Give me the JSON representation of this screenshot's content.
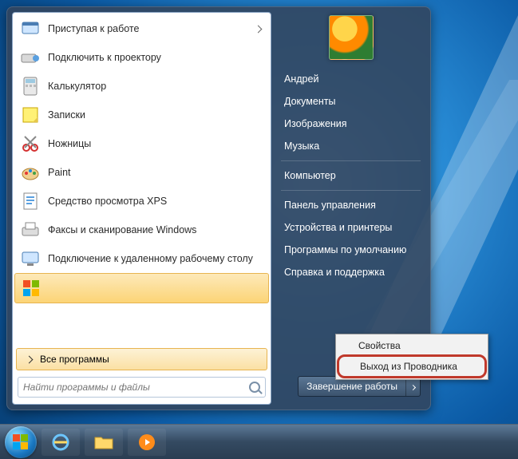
{
  "programs": [
    {
      "label": "Приступая к работе",
      "icon": "getting-started",
      "hasSubmenu": true
    },
    {
      "label": "Подключить к проектору",
      "icon": "projector"
    },
    {
      "label": "Калькулятор",
      "icon": "calculator"
    },
    {
      "label": "Записки",
      "icon": "sticky-notes"
    },
    {
      "label": "Ножницы",
      "icon": "snipping"
    },
    {
      "label": "Paint",
      "icon": "paint"
    },
    {
      "label": "Средство просмотра XPS",
      "icon": "xps-viewer"
    },
    {
      "label": "Факсы и сканирование Windows",
      "icon": "fax-scan"
    },
    {
      "label": "Подключение к удаленному рабочему столу",
      "icon": "remote-desktop"
    },
    {
      "label": "",
      "icon": "win-squares",
      "selected": true
    }
  ],
  "allPrograms": "Все программы",
  "search": {
    "placeholder": "Найти программы и файлы"
  },
  "user": {
    "name": "Андрей"
  },
  "rightItems": [
    "Документы",
    "Изображения",
    "Музыка"
  ],
  "rightItems2": [
    "Компьютер"
  ],
  "rightItems3": [
    "Панель управления",
    "Устройства и принтеры",
    "Программы по умолчанию",
    "Справка и поддержка"
  ],
  "shutdown": {
    "label": "Завершение работы"
  },
  "contextMenu": {
    "items": [
      "Свойства",
      "Выход из Проводника"
    ],
    "highlightIndex": 1
  }
}
